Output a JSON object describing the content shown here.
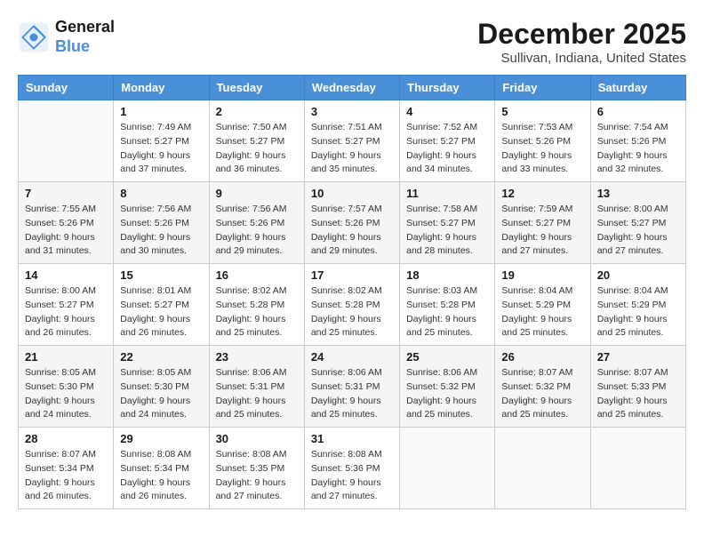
{
  "header": {
    "logo_line1": "General",
    "logo_line2": "Blue",
    "title": "December 2025",
    "subtitle": "Sullivan, Indiana, United States"
  },
  "days_of_week": [
    "Sunday",
    "Monday",
    "Tuesday",
    "Wednesday",
    "Thursday",
    "Friday",
    "Saturday"
  ],
  "weeks": [
    [
      {
        "day": "",
        "info": ""
      },
      {
        "day": "1",
        "info": "Sunrise: 7:49 AM\nSunset: 5:27 PM\nDaylight: 9 hours\nand 37 minutes."
      },
      {
        "day": "2",
        "info": "Sunrise: 7:50 AM\nSunset: 5:27 PM\nDaylight: 9 hours\nand 36 minutes."
      },
      {
        "day": "3",
        "info": "Sunrise: 7:51 AM\nSunset: 5:27 PM\nDaylight: 9 hours\nand 35 minutes."
      },
      {
        "day": "4",
        "info": "Sunrise: 7:52 AM\nSunset: 5:27 PM\nDaylight: 9 hours\nand 34 minutes."
      },
      {
        "day": "5",
        "info": "Sunrise: 7:53 AM\nSunset: 5:26 PM\nDaylight: 9 hours\nand 33 minutes."
      },
      {
        "day": "6",
        "info": "Sunrise: 7:54 AM\nSunset: 5:26 PM\nDaylight: 9 hours\nand 32 minutes."
      }
    ],
    [
      {
        "day": "7",
        "info": "Sunrise: 7:55 AM\nSunset: 5:26 PM\nDaylight: 9 hours\nand 31 minutes."
      },
      {
        "day": "8",
        "info": "Sunrise: 7:56 AM\nSunset: 5:26 PM\nDaylight: 9 hours\nand 30 minutes."
      },
      {
        "day": "9",
        "info": "Sunrise: 7:56 AM\nSunset: 5:26 PM\nDaylight: 9 hours\nand 29 minutes."
      },
      {
        "day": "10",
        "info": "Sunrise: 7:57 AM\nSunset: 5:26 PM\nDaylight: 9 hours\nand 29 minutes."
      },
      {
        "day": "11",
        "info": "Sunrise: 7:58 AM\nSunset: 5:27 PM\nDaylight: 9 hours\nand 28 minutes."
      },
      {
        "day": "12",
        "info": "Sunrise: 7:59 AM\nSunset: 5:27 PM\nDaylight: 9 hours\nand 27 minutes."
      },
      {
        "day": "13",
        "info": "Sunrise: 8:00 AM\nSunset: 5:27 PM\nDaylight: 9 hours\nand 27 minutes."
      }
    ],
    [
      {
        "day": "14",
        "info": "Sunrise: 8:00 AM\nSunset: 5:27 PM\nDaylight: 9 hours\nand 26 minutes."
      },
      {
        "day": "15",
        "info": "Sunrise: 8:01 AM\nSunset: 5:27 PM\nDaylight: 9 hours\nand 26 minutes."
      },
      {
        "day": "16",
        "info": "Sunrise: 8:02 AM\nSunset: 5:28 PM\nDaylight: 9 hours\nand 25 minutes."
      },
      {
        "day": "17",
        "info": "Sunrise: 8:02 AM\nSunset: 5:28 PM\nDaylight: 9 hours\nand 25 minutes."
      },
      {
        "day": "18",
        "info": "Sunrise: 8:03 AM\nSunset: 5:28 PM\nDaylight: 9 hours\nand 25 minutes."
      },
      {
        "day": "19",
        "info": "Sunrise: 8:04 AM\nSunset: 5:29 PM\nDaylight: 9 hours\nand 25 minutes."
      },
      {
        "day": "20",
        "info": "Sunrise: 8:04 AM\nSunset: 5:29 PM\nDaylight: 9 hours\nand 25 minutes."
      }
    ],
    [
      {
        "day": "21",
        "info": "Sunrise: 8:05 AM\nSunset: 5:30 PM\nDaylight: 9 hours\nand 24 minutes."
      },
      {
        "day": "22",
        "info": "Sunrise: 8:05 AM\nSunset: 5:30 PM\nDaylight: 9 hours\nand 24 minutes."
      },
      {
        "day": "23",
        "info": "Sunrise: 8:06 AM\nSunset: 5:31 PM\nDaylight: 9 hours\nand 25 minutes."
      },
      {
        "day": "24",
        "info": "Sunrise: 8:06 AM\nSunset: 5:31 PM\nDaylight: 9 hours\nand 25 minutes."
      },
      {
        "day": "25",
        "info": "Sunrise: 8:06 AM\nSunset: 5:32 PM\nDaylight: 9 hours\nand 25 minutes."
      },
      {
        "day": "26",
        "info": "Sunrise: 8:07 AM\nSunset: 5:32 PM\nDaylight: 9 hours\nand 25 minutes."
      },
      {
        "day": "27",
        "info": "Sunrise: 8:07 AM\nSunset: 5:33 PM\nDaylight: 9 hours\nand 25 minutes."
      }
    ],
    [
      {
        "day": "28",
        "info": "Sunrise: 8:07 AM\nSunset: 5:34 PM\nDaylight: 9 hours\nand 26 minutes."
      },
      {
        "day": "29",
        "info": "Sunrise: 8:08 AM\nSunset: 5:34 PM\nDaylight: 9 hours\nand 26 minutes."
      },
      {
        "day": "30",
        "info": "Sunrise: 8:08 AM\nSunset: 5:35 PM\nDaylight: 9 hours\nand 27 minutes."
      },
      {
        "day": "31",
        "info": "Sunrise: 8:08 AM\nSunset: 5:36 PM\nDaylight: 9 hours\nand 27 minutes."
      },
      {
        "day": "",
        "info": ""
      },
      {
        "day": "",
        "info": ""
      },
      {
        "day": "",
        "info": ""
      }
    ]
  ]
}
